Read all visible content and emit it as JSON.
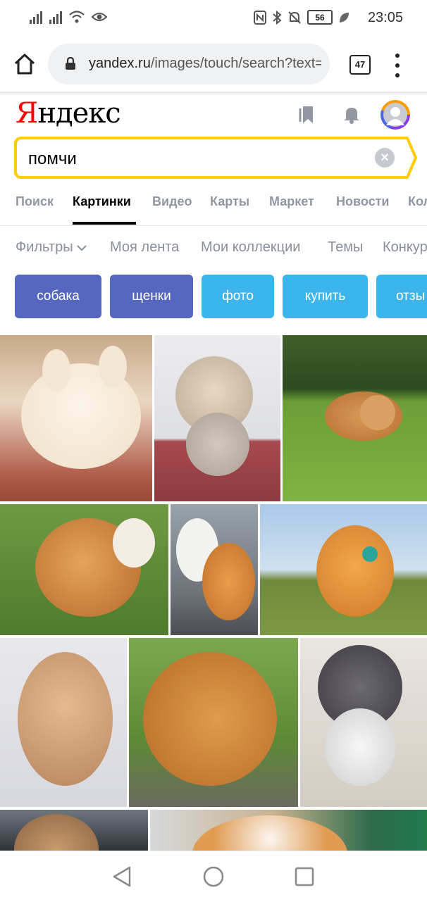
{
  "status_bar": {
    "time": "23:05",
    "battery": "56"
  },
  "browser": {
    "url_host": "yandex.ru",
    "url_path": "/images/touch/search?text=",
    "tab_count": "47"
  },
  "header": {
    "logo_first": "Я",
    "logo_rest": "ндекс"
  },
  "search": {
    "query": "помчи"
  },
  "service_tabs": [
    {
      "label": "Поиск"
    },
    {
      "label": "Картинки"
    },
    {
      "label": "Видео"
    },
    {
      "label": "Карты"
    },
    {
      "label": "Маркет"
    },
    {
      "label": "Новости"
    },
    {
      "label": "Кол"
    }
  ],
  "filters": {
    "filters_label": "Фильтры",
    "items": [
      {
        "label": "Моя лента"
      },
      {
        "label": "Мои коллекции"
      },
      {
        "label": "Темы"
      },
      {
        "label": "Конкур"
      }
    ]
  },
  "chips": [
    {
      "label": "собака",
      "color": "#5567bf"
    },
    {
      "label": "щенки",
      "color": "#5567bf"
    },
    {
      "label": "фото",
      "color": "#3cb5ec"
    },
    {
      "label": "купить",
      "color": "#3cb5ec"
    },
    {
      "label": "отзы",
      "color": "#3cb5ec"
    }
  ],
  "colors": {
    "accent_yellow": "#ffcc00",
    "logo_red": "#ff0000"
  }
}
